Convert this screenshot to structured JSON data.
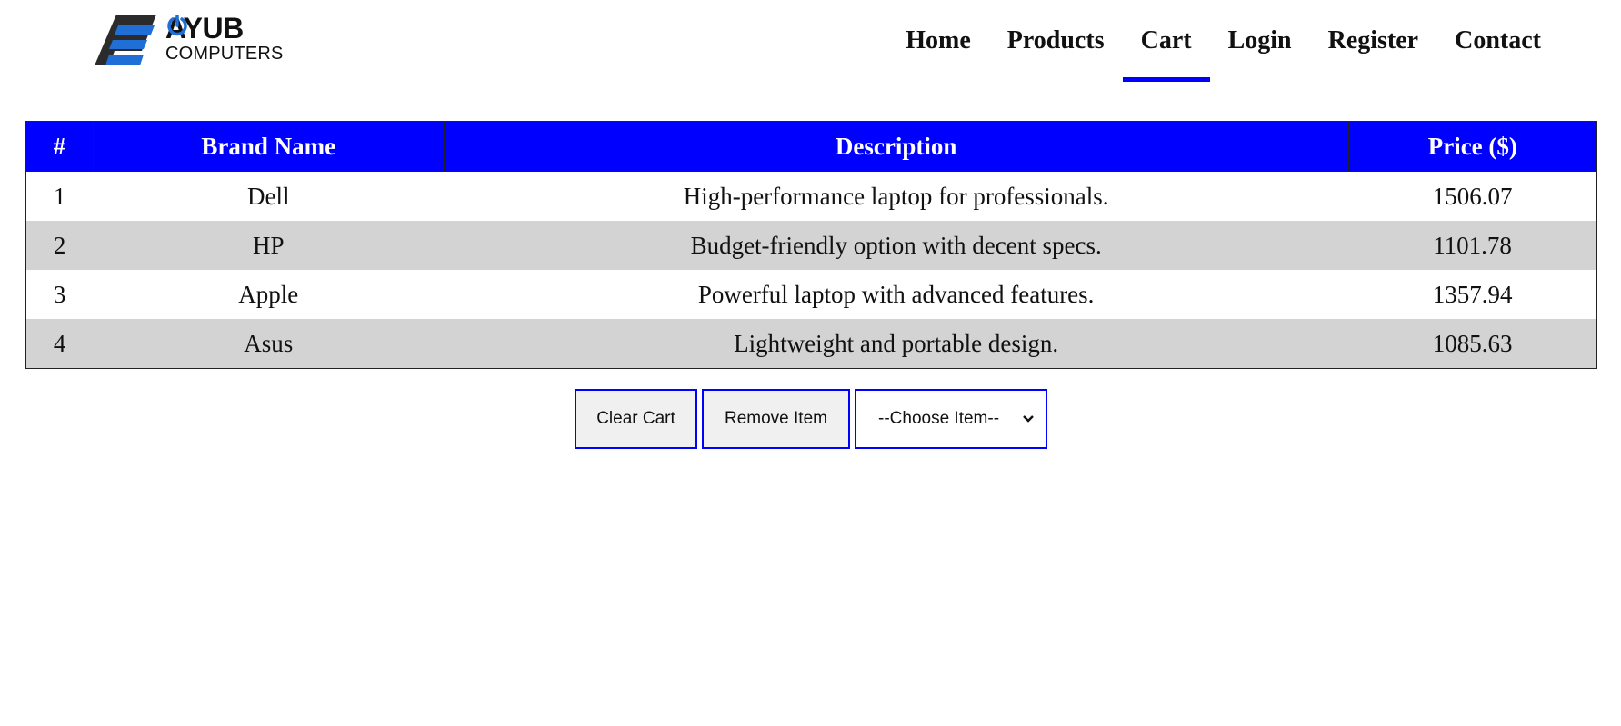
{
  "logo": {
    "line1_left": "AY",
    "line1_right": "UB",
    "line2": "COMPUTERS",
    "accent": "#1f6fd6"
  },
  "nav": {
    "items": [
      {
        "label": "Home"
      },
      {
        "label": "Products"
      },
      {
        "label": "Cart",
        "active": true
      },
      {
        "label": "Login"
      },
      {
        "label": "Register"
      },
      {
        "label": "Contact"
      }
    ]
  },
  "table": {
    "headers": [
      "#",
      "Brand Name",
      "Description",
      "Price ($)"
    ],
    "rows": [
      [
        "1",
        "Dell",
        "High-performance laptop for professionals.",
        "1506.07"
      ],
      [
        "2",
        "HP",
        "Budget-friendly option with decent specs.",
        "1101.78"
      ],
      [
        "3",
        "Apple",
        "Powerful laptop with advanced features.",
        "1357.94"
      ],
      [
        "4",
        "Asus",
        "Lightweight and portable design.",
        "1085.63"
      ]
    ],
    "header_color": "#0000ff",
    "stripe_color": "#d3d3d3"
  },
  "controls": {
    "clear_label": "Clear Cart",
    "remove_label": "Remove Item",
    "select_value": "--Choose Item--"
  }
}
